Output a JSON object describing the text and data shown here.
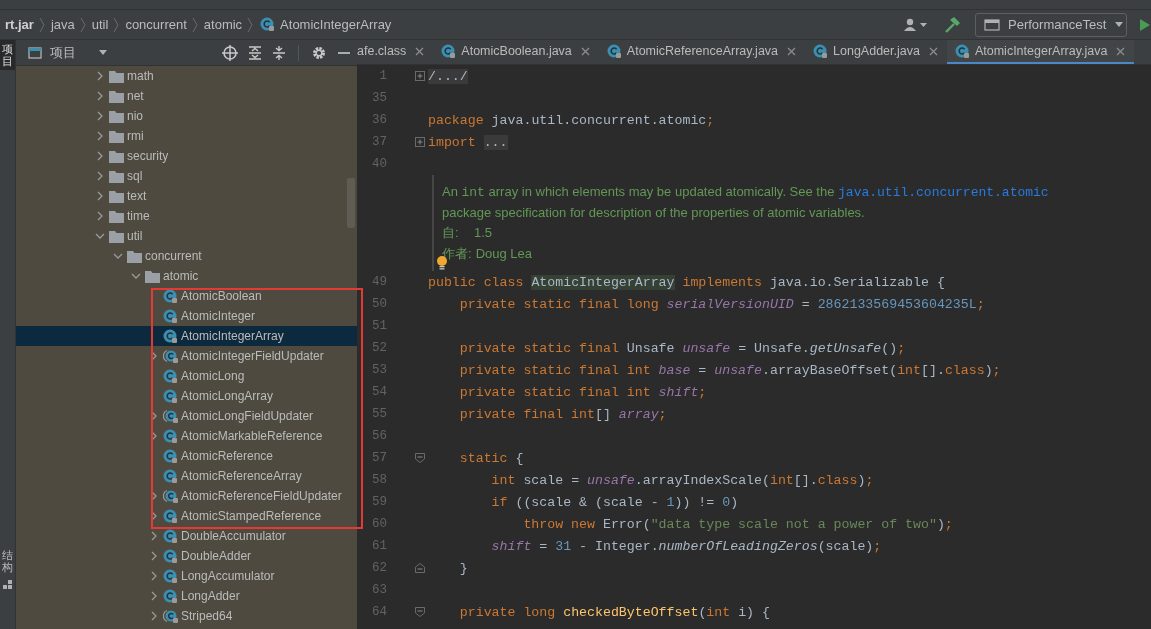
{
  "breadcrumb": {
    "items": [
      {
        "label": "rt.jar",
        "kind": "jar"
      },
      {
        "label": "java",
        "kind": "package"
      },
      {
        "label": "util",
        "kind": "package"
      },
      {
        "label": "concurrent",
        "kind": "package"
      },
      {
        "label": "atomic",
        "kind": "package"
      },
      {
        "label": "AtomicIntegerArray",
        "kind": "class"
      }
    ]
  },
  "toolbar": {
    "run_config": "PerformanceTest"
  },
  "side_stripe": {
    "items": [
      {
        "label": "项目",
        "selected": true,
        "kind": "project"
      },
      {
        "label": "结构",
        "selected": false,
        "kind": "structure"
      }
    ]
  },
  "project_panel": {
    "title": "项目",
    "tree": [
      {
        "kind": "folder",
        "label": "math",
        "has_children": true,
        "expanded": false,
        "selected": false
      },
      {
        "kind": "folder",
        "label": "net",
        "has_children": true,
        "expanded": false,
        "selected": false
      },
      {
        "kind": "folder",
        "label": "nio",
        "has_children": true,
        "expanded": false,
        "selected": false
      },
      {
        "kind": "folder",
        "label": "rmi",
        "has_children": true,
        "expanded": false,
        "selected": false
      },
      {
        "kind": "folder",
        "label": "security",
        "has_children": true,
        "expanded": false,
        "selected": false
      },
      {
        "kind": "folder",
        "label": "sql",
        "has_children": true,
        "expanded": false,
        "selected": false
      },
      {
        "kind": "folder",
        "label": "text",
        "has_children": true,
        "expanded": false,
        "selected": false
      },
      {
        "kind": "folder",
        "label": "time",
        "has_children": true,
        "expanded": false,
        "selected": false
      },
      {
        "kind": "folder",
        "label": "util",
        "has_children": true,
        "expanded": true,
        "selected": false,
        "children": [
          {
            "kind": "folder",
            "label": "concurrent",
            "has_children": true,
            "expanded": true,
            "selected": false,
            "children": [
              {
                "kind": "folder",
                "label": "atomic",
                "has_children": true,
                "expanded": true,
                "selected": false,
                "children": [
                  {
                    "kind": "class",
                    "label": "AtomicBoolean",
                    "has_children": false,
                    "selected": false
                  },
                  {
                    "kind": "class",
                    "label": "AtomicInteger",
                    "has_children": false,
                    "selected": false
                  },
                  {
                    "kind": "class",
                    "label": "AtomicIntegerArray",
                    "has_children": false,
                    "selected": true
                  },
                  {
                    "kind": "abstract",
                    "label": "AtomicIntegerFieldUpdater",
                    "has_children": true,
                    "expanded": false,
                    "selected": false
                  },
                  {
                    "kind": "class",
                    "label": "AtomicLong",
                    "has_children": false,
                    "selected": false
                  },
                  {
                    "kind": "class",
                    "label": "AtomicLongArray",
                    "has_children": false,
                    "selected": false
                  },
                  {
                    "kind": "abstract",
                    "label": "AtomicLongFieldUpdater",
                    "has_children": true,
                    "expanded": false,
                    "selected": false
                  },
                  {
                    "kind": "class",
                    "label": "AtomicMarkableReference",
                    "has_children": true,
                    "expanded": false,
                    "selected": false
                  },
                  {
                    "kind": "class",
                    "label": "AtomicReference",
                    "has_children": false,
                    "selected": false
                  },
                  {
                    "kind": "class",
                    "label": "AtomicReferenceArray",
                    "has_children": false,
                    "selected": false
                  },
                  {
                    "kind": "abstract",
                    "label": "AtomicReferenceFieldUpdater",
                    "has_children": true,
                    "expanded": false,
                    "selected": false
                  },
                  {
                    "kind": "class",
                    "label": "AtomicStampedReference",
                    "has_children": true,
                    "expanded": false,
                    "selected": false
                  },
                  {
                    "kind": "class",
                    "label": "DoubleAccumulator",
                    "has_children": true,
                    "expanded": false,
                    "selected": false
                  },
                  {
                    "kind": "class",
                    "label": "DoubleAdder",
                    "has_children": true,
                    "expanded": false,
                    "selected": false
                  },
                  {
                    "kind": "class",
                    "label": "LongAccumulator",
                    "has_children": true,
                    "expanded": false,
                    "selected": false
                  },
                  {
                    "kind": "class",
                    "label": "LongAdder",
                    "has_children": true,
                    "expanded": false,
                    "selected": false
                  },
                  {
                    "kind": "abstract",
                    "label": "Striped64",
                    "has_children": true,
                    "expanded": false,
                    "selected": false
                  }
                ]
              }
            ]
          }
        ]
      }
    ]
  },
  "tabs": [
    {
      "label": "afe.class",
      "kind": "cut",
      "selected": false
    },
    {
      "label": "AtomicBoolean.java",
      "kind": "class",
      "selected": false
    },
    {
      "label": "AtomicReferenceArray.java",
      "kind": "class",
      "selected": false
    },
    {
      "label": "LongAdder.java",
      "kind": "class",
      "selected": false
    },
    {
      "label": "AtomicIntegerArray.java",
      "kind": "class",
      "selected": true
    }
  ],
  "editor": {
    "lines_before_doc": [
      {
        "number": "1",
        "kind": "fold-collapsed",
        "tokens": [
          {
            "kind": "folded",
            "text": "/.../"
          }
        ]
      },
      {
        "number": "35",
        "kind": "plain"
      },
      {
        "number": "36",
        "kind": "plain",
        "tokens": [
          {
            "kind": "keyword",
            "text": "package"
          },
          {
            "kind": "plain",
            "text": " java.util.concurrent.atomic"
          },
          {
            "kind": "keyword",
            "text": ";"
          }
        ]
      },
      {
        "number": "37",
        "kind": "fold-collapsed",
        "tokens": [
          {
            "kind": "keyword",
            "text": "import "
          },
          {
            "kind": "folded",
            "text": "..."
          }
        ]
      },
      {
        "number": "40",
        "kind": "plain"
      }
    ],
    "doc": {
      "segments": [
        {
          "kind": "text",
          "text": "An "
        },
        {
          "kind": "code",
          "text": "int"
        },
        {
          "kind": "text",
          "text": " array in which elements may be updated atomically. See the "
        },
        {
          "kind": "link",
          "text": "java.util.concurrent.atomic"
        },
        {
          "kind": "text",
          "text": " package specification for description of the properties of atomic variables."
        }
      ],
      "since_label": "自:",
      "since": "1.5",
      "author_label": "作者:",
      "author": "Doug Lea"
    },
    "lines_after_doc": [
      {
        "number": "49",
        "kind": "plain",
        "tokens": [
          {
            "kind": "keyword",
            "text": "public class "
          },
          {
            "kind": "classref",
            "text": "AtomicIntegerArray"
          },
          {
            "kind": "keyword",
            "text": " implements "
          },
          {
            "kind": "plain",
            "text": "java.io.Serializable {"
          }
        ]
      },
      {
        "number": "50",
        "kind": "plain",
        "tokens": [
          {
            "kind": "keyword",
            "text": "    private static final long "
          },
          {
            "kind": "field",
            "text": "serialVersionUID"
          },
          {
            "kind": "plain",
            "text": " = "
          },
          {
            "kind": "number",
            "text": "2862133569453604235L"
          },
          {
            "kind": "keyword",
            "text": ";"
          }
        ]
      },
      {
        "number": "51",
        "kind": "plain"
      },
      {
        "number": "52",
        "kind": "plain",
        "tokens": [
          {
            "kind": "keyword",
            "text": "    private static final "
          },
          {
            "kind": "plain",
            "text": "Unsafe "
          },
          {
            "kind": "field",
            "text": "unsafe"
          },
          {
            "kind": "plain",
            "text": " = Unsafe."
          },
          {
            "kind": "static",
            "text": "getUnsafe"
          },
          {
            "kind": "plain",
            "text": "()"
          },
          {
            "kind": "keyword",
            "text": ";"
          }
        ]
      },
      {
        "number": "53",
        "kind": "plain",
        "tokens": [
          {
            "kind": "keyword",
            "text": "    private static final int "
          },
          {
            "kind": "field",
            "text": "base"
          },
          {
            "kind": "plain",
            "text": " = "
          },
          {
            "kind": "field",
            "text": "unsafe"
          },
          {
            "kind": "plain",
            "text": ".arrayBaseOffset("
          },
          {
            "kind": "keyword",
            "text": "int"
          },
          {
            "kind": "plain",
            "text": "[]."
          },
          {
            "kind": "keyword",
            "text": "class"
          },
          {
            "kind": "plain",
            "text": ")"
          },
          {
            "kind": "keyword",
            "text": ";"
          }
        ]
      },
      {
        "number": "54",
        "kind": "plain",
        "tokens": [
          {
            "kind": "keyword",
            "text": "    private static final int "
          },
          {
            "kind": "field",
            "text": "shift"
          },
          {
            "kind": "keyword",
            "text": ";"
          }
        ]
      },
      {
        "number": "55",
        "kind": "plain",
        "tokens": [
          {
            "kind": "keyword",
            "text": "    private final int"
          },
          {
            "kind": "plain",
            "text": "[] "
          },
          {
            "kind": "field",
            "text": "array"
          },
          {
            "kind": "keyword",
            "text": ";"
          }
        ]
      },
      {
        "number": "56",
        "kind": "plain"
      },
      {
        "number": "57",
        "kind": "fold-start",
        "tokens": [
          {
            "kind": "keyword",
            "text": "    static "
          },
          {
            "kind": "plain",
            "text": "{"
          }
        ]
      },
      {
        "number": "58",
        "kind": "plain",
        "tokens": [
          {
            "kind": "keyword",
            "text": "        int "
          },
          {
            "kind": "plain",
            "text": "scale = "
          },
          {
            "kind": "field",
            "text": "unsafe"
          },
          {
            "kind": "plain",
            "text": ".arrayIndexScale("
          },
          {
            "kind": "keyword",
            "text": "int"
          },
          {
            "kind": "plain",
            "text": "[]."
          },
          {
            "kind": "keyword",
            "text": "class"
          },
          {
            "kind": "plain",
            "text": ")"
          },
          {
            "kind": "keyword",
            "text": ";"
          }
        ]
      },
      {
        "number": "59",
        "kind": "plain",
        "tokens": [
          {
            "kind": "keyword",
            "text": "        if "
          },
          {
            "kind": "plain",
            "text": "((scale & (scale - "
          },
          {
            "kind": "number",
            "text": "1"
          },
          {
            "kind": "plain",
            "text": ")) != "
          },
          {
            "kind": "number",
            "text": "0"
          },
          {
            "kind": "plain",
            "text": ")"
          }
        ]
      },
      {
        "number": "60",
        "kind": "plain",
        "tokens": [
          {
            "kind": "keyword",
            "text": "            throw new "
          },
          {
            "kind": "plain",
            "text": "Error("
          },
          {
            "kind": "string",
            "text": "\"data type scale not a power of two\""
          },
          {
            "kind": "plain",
            "text": ")"
          },
          {
            "kind": "keyword",
            "text": ";"
          }
        ]
      },
      {
        "number": "61",
        "kind": "plain",
        "tokens": [
          {
            "kind": "field",
            "text": "        shift"
          },
          {
            "kind": "plain",
            "text": " = "
          },
          {
            "kind": "number",
            "text": "31"
          },
          {
            "kind": "plain",
            "text": " - Integer."
          },
          {
            "kind": "static",
            "text": "numberOfLeadingZeros"
          },
          {
            "kind": "plain",
            "text": "(scale)"
          },
          {
            "kind": "keyword",
            "text": ";"
          }
        ]
      },
      {
        "number": "62",
        "kind": "fold-end",
        "tokens": [
          {
            "kind": "plain",
            "text": "    }"
          }
        ]
      },
      {
        "number": "63",
        "kind": "plain"
      },
      {
        "number": "64",
        "kind": "fold-start",
        "tokens": [
          {
            "kind": "keyword",
            "text": "    private long "
          },
          {
            "kind": "method",
            "text": "checkedByteOffset"
          },
          {
            "kind": "plain",
            "text": "("
          },
          {
            "kind": "keyword",
            "text": "int "
          },
          {
            "kind": "plain",
            "text": "i) {"
          }
        ]
      }
    ]
  }
}
